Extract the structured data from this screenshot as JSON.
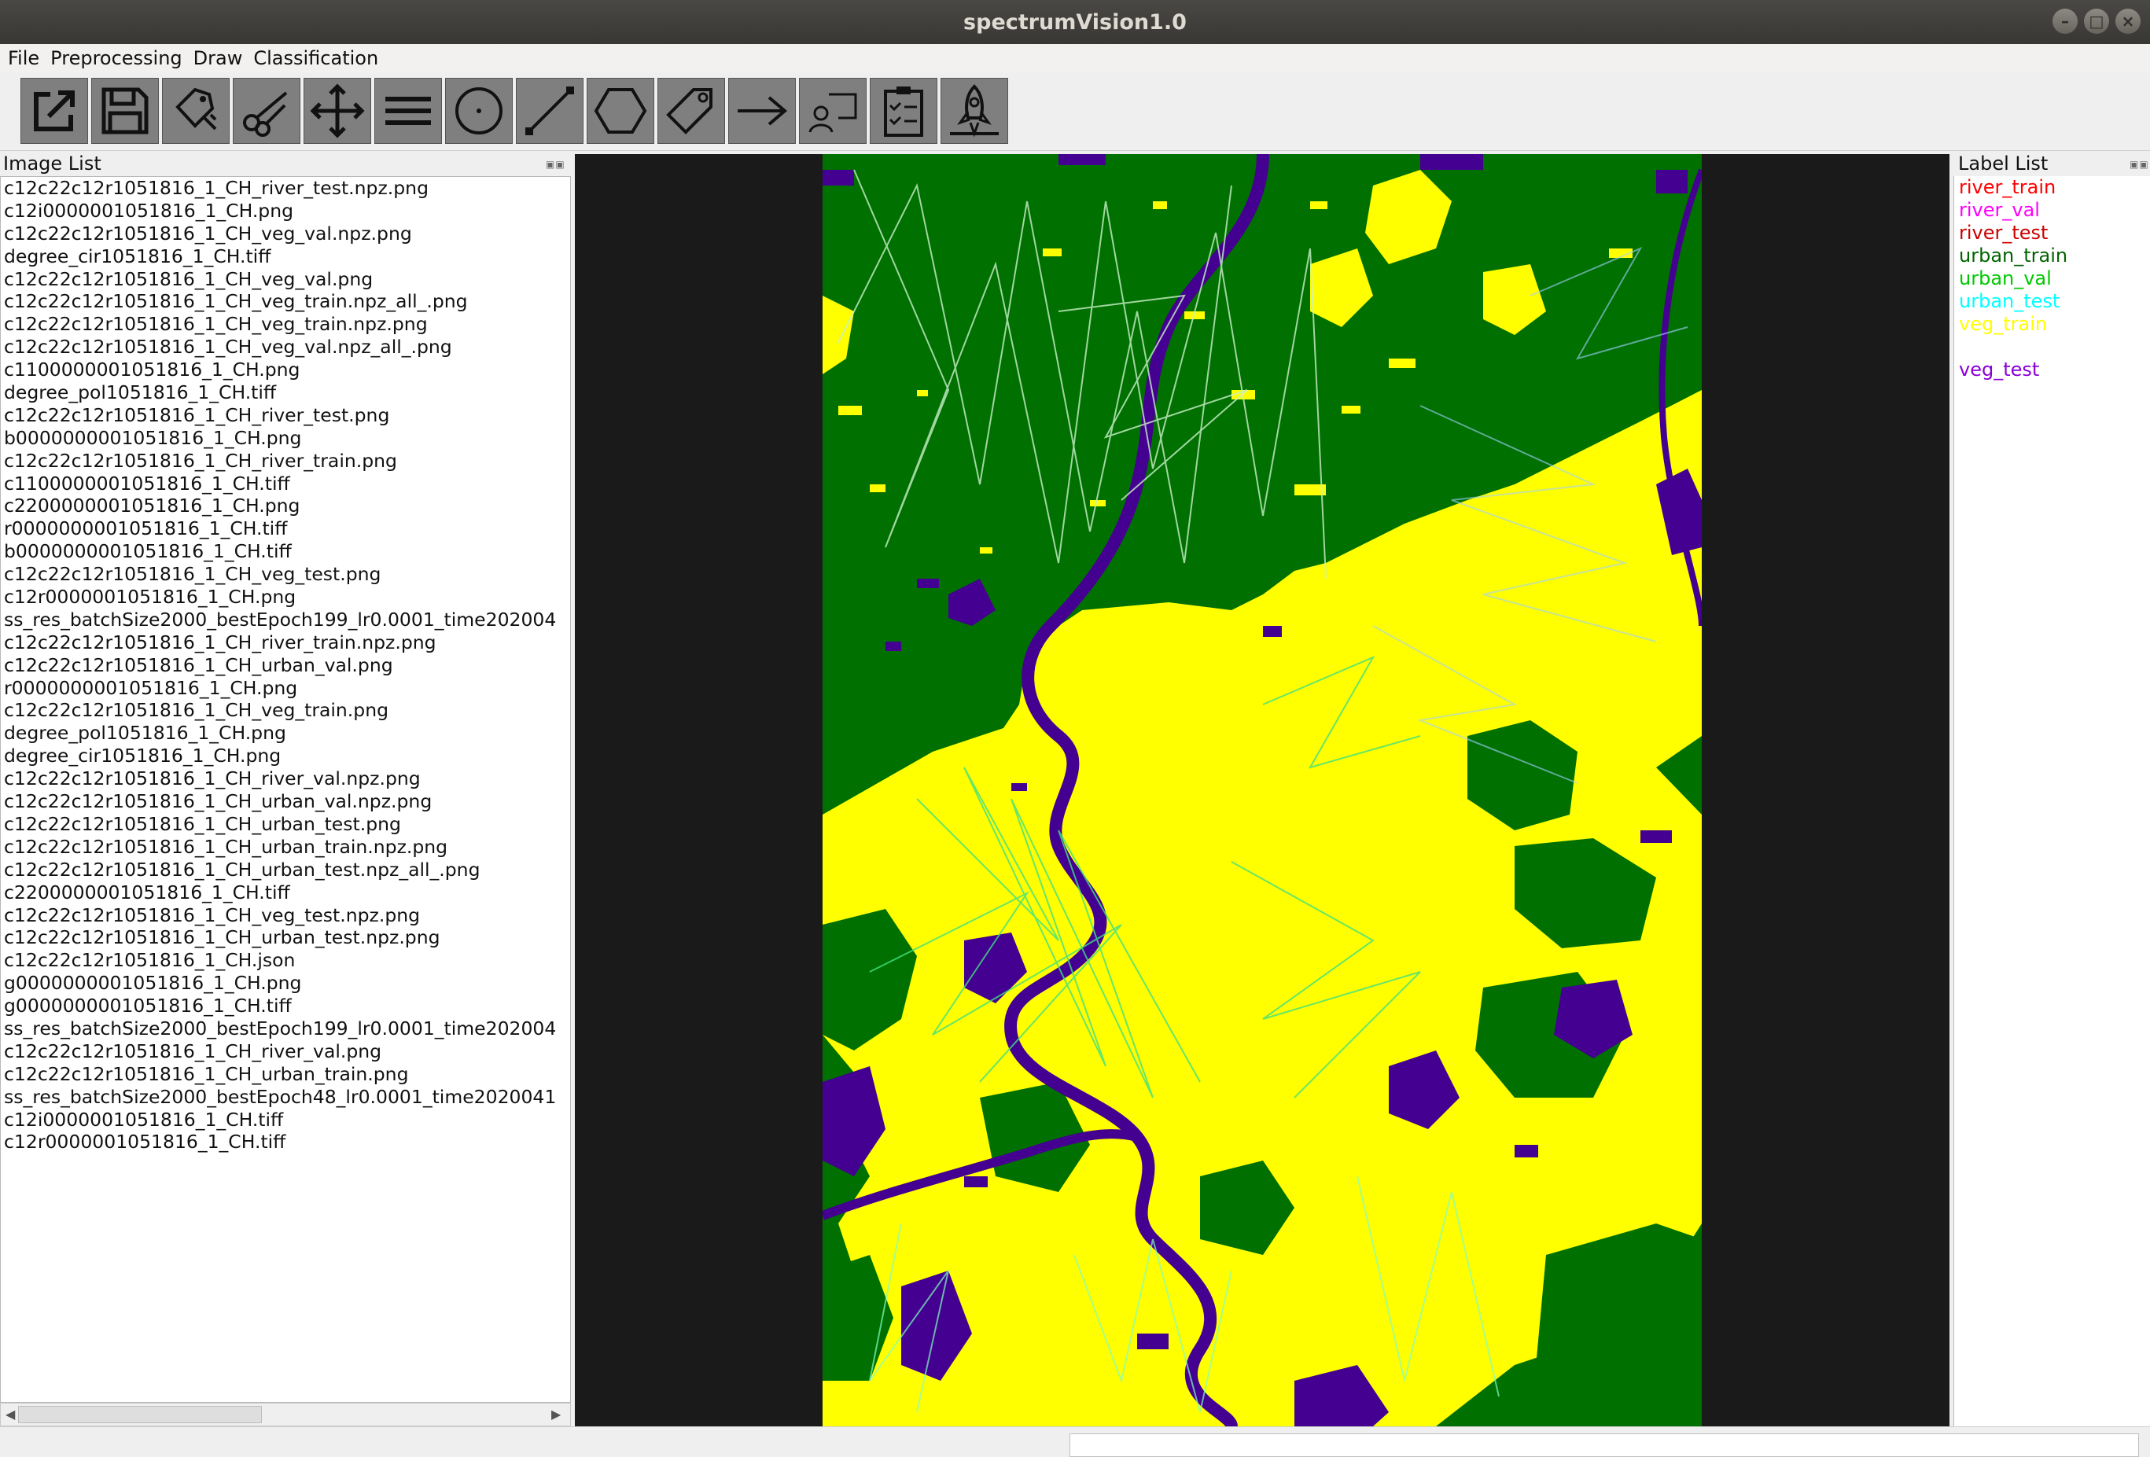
{
  "window": {
    "title": "spectrumVision1.0"
  },
  "menu": [
    "File",
    "Preprocessing",
    "Draw",
    "Classification"
  ],
  "toolbar": {
    "tools": [
      {
        "name": "open-icon"
      },
      {
        "name": "save-icon"
      },
      {
        "name": "tag-edit-icon"
      },
      {
        "name": "scissors-icon"
      },
      {
        "name": "move-icon"
      },
      {
        "name": "lines-icon"
      },
      {
        "name": "circle-icon"
      },
      {
        "name": "line-icon"
      },
      {
        "name": "hexagon-icon"
      },
      {
        "name": "tag-icon"
      },
      {
        "name": "arrow-icon"
      },
      {
        "name": "user-icon"
      },
      {
        "name": "clipboard-icon"
      },
      {
        "name": "rocket-icon"
      }
    ]
  },
  "image_list": {
    "title": "Image List",
    "items": [
      "c12c22c12r1051816_1_CH_river_test.npz.png",
      "c12i0000001051816_1_CH.png",
      "c12c22c12r1051816_1_CH_veg_val.npz.png",
      "degree_cir1051816_1_CH.tiff",
      "c12c22c12r1051816_1_CH_veg_val.png",
      "c12c22c12r1051816_1_CH_veg_train.npz_all_.png",
      "c12c22c12r1051816_1_CH_veg_train.npz.png",
      "c12c22c12r1051816_1_CH_veg_val.npz_all_.png",
      "c1100000001051816_1_CH.png",
      "degree_pol1051816_1_CH.tiff",
      "c12c22c12r1051816_1_CH_river_test.png",
      "b0000000001051816_1_CH.png",
      "c12c22c12r1051816_1_CH_river_train.png",
      "c1100000001051816_1_CH.tiff",
      "c2200000001051816_1_CH.png",
      "r0000000001051816_1_CH.tiff",
      "b0000000001051816_1_CH.tiff",
      "c12c22c12r1051816_1_CH_veg_test.png",
      "c12r0000001051816_1_CH.png",
      "ss_res_batchSize2000_bestEpoch199_lr0.0001_time202004",
      "c12c22c12r1051816_1_CH_river_train.npz.png",
      "c12c22c12r1051816_1_CH_urban_val.png",
      "r0000000001051816_1_CH.png",
      "c12c22c12r1051816_1_CH_veg_train.png",
      "degree_pol1051816_1_CH.png",
      "degree_cir1051816_1_CH.png",
      "c12c22c12r1051816_1_CH_river_val.npz.png",
      "c12c22c12r1051816_1_CH_urban_val.npz.png",
      "c12c22c12r1051816_1_CH_urban_test.png",
      "c12c22c12r1051816_1_CH_urban_train.npz.png",
      "c12c22c12r1051816_1_CH_urban_test.npz_all_.png",
      "c2200000001051816_1_CH.tiff",
      "c12c22c12r1051816_1_CH_veg_test.npz.png",
      "c12c22c12r1051816_1_CH_urban_test.npz.png",
      "c12c22c12r1051816_1_CH.json",
      "g0000000001051816_1_CH.png",
      "g0000000001051816_1_CH.tiff",
      "ss_res_batchSize2000_bestEpoch199_lr0.0001_time202004",
      "c12c22c12r1051816_1_CH_river_val.png",
      "c12c22c12r1051816_1_CH_urban_train.png",
      "ss_res_batchSize2000_bestEpoch48_lr0.0001_time2020041",
      "c12i0000001051816_1_CH.tiff",
      "c12r0000001051816_1_CH.tiff"
    ]
  },
  "label_list": {
    "title": "Label List",
    "items": [
      {
        "text": "river_train",
        "color": "#ff0000"
      },
      {
        "text": "river_val",
        "color": "#ff00ff"
      },
      {
        "text": "river_test",
        "color": "#cc0000"
      },
      {
        "text": "urban_train",
        "color": "#006400"
      },
      {
        "text": "urban_val",
        "color": "#00c800"
      },
      {
        "text": "urban_test",
        "color": "#00ffff"
      },
      {
        "text": "veg_train",
        "color": "#ffff00"
      },
      {
        "text": "",
        "color": "#ffffff"
      },
      {
        "text": "veg_test",
        "color": "#8a00d4"
      }
    ]
  },
  "colors": {
    "class_vegetation": "#007000",
    "class_urban": "#ffff00",
    "class_water": "#440090",
    "canvas_background": "#1a1a1a"
  }
}
